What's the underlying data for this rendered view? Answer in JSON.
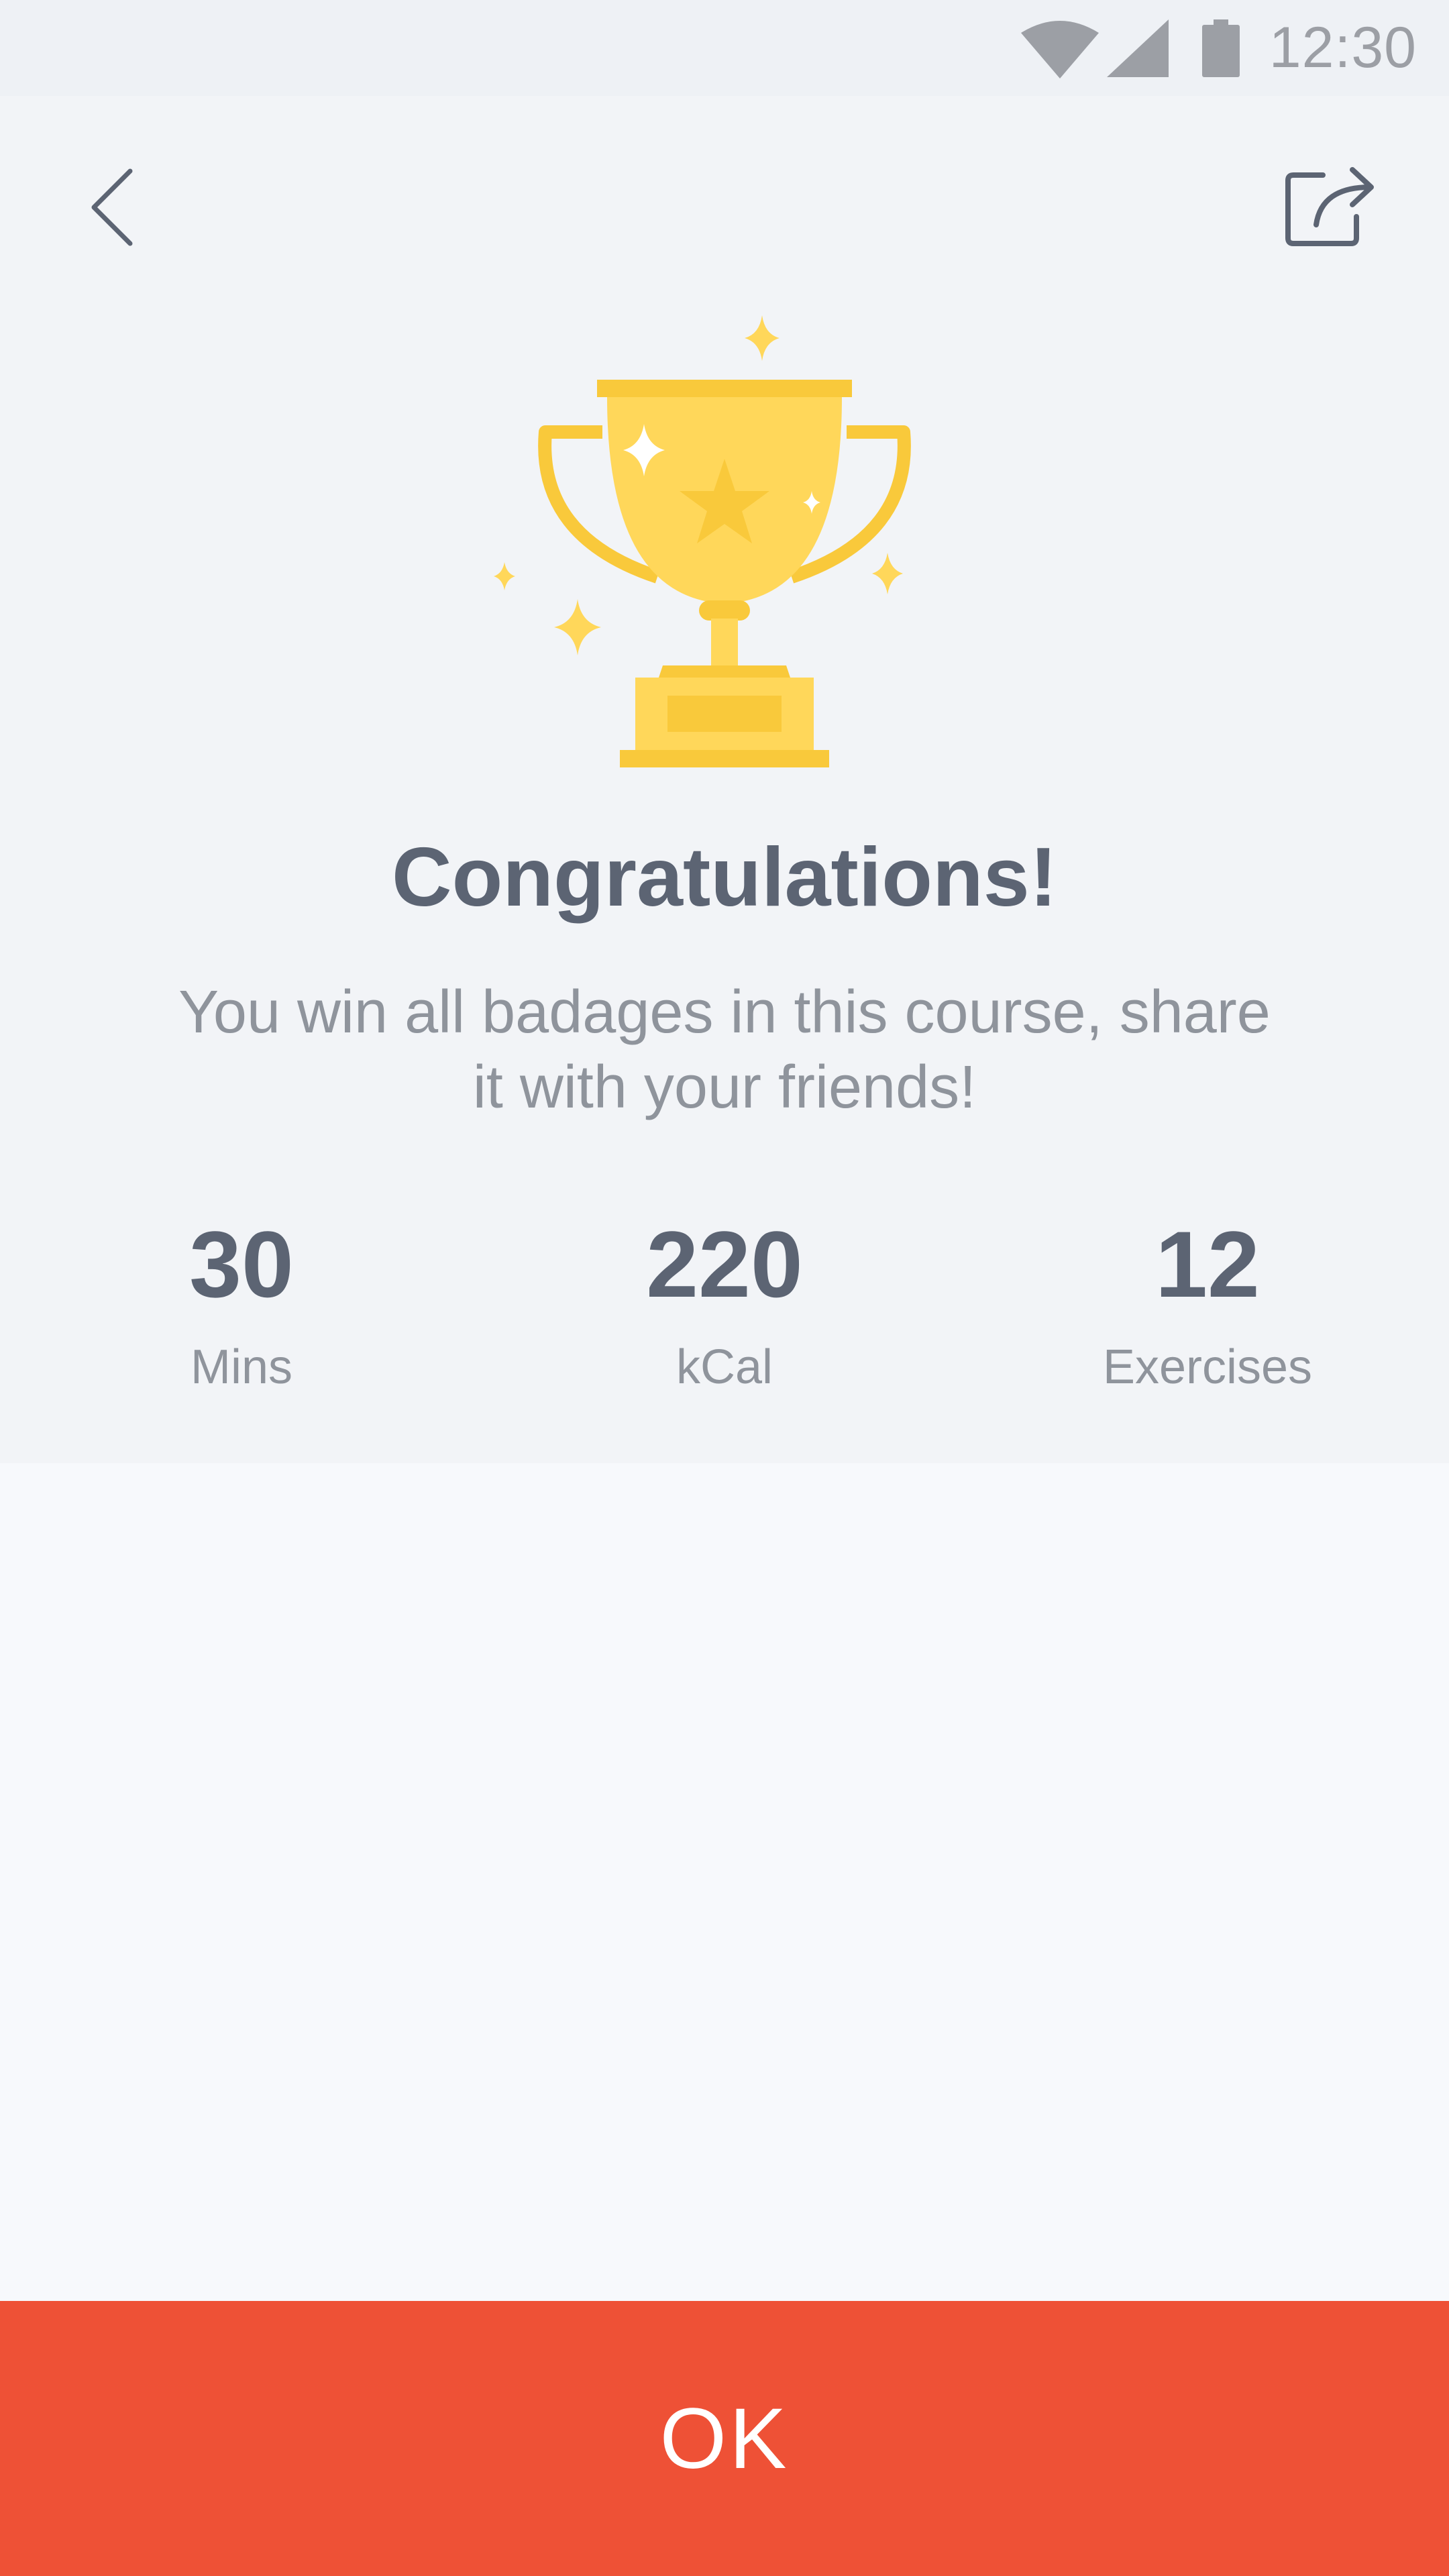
{
  "status_bar": {
    "time": "12:30",
    "icons": [
      "wifi-icon",
      "cellular-signal-icon",
      "battery-icon"
    ]
  },
  "header": {
    "back_icon": "chevron-left-icon",
    "share_icon": "share-icon"
  },
  "hero": {
    "illustration": "trophy-icon",
    "title": "Congratulations!",
    "subtitle_line1": "You win all badages in this course, share",
    "subtitle_line2": "it with your friends!"
  },
  "stats": [
    {
      "value": "30",
      "label": "Mins"
    },
    {
      "value": "220",
      "label": "kCal"
    },
    {
      "value": "12",
      "label": "Exercises"
    }
  ],
  "footer": {
    "ok_label": "OK"
  },
  "colors": {
    "accent": "#EE5136",
    "trophy_gold": "#FFD75A",
    "trophy_gold_dark": "#F9C93B",
    "text_dark": "#5C6473",
    "text_muted": "#8F949C",
    "hero_background": "#F2F4F7",
    "page_background": "#F7F9FC"
  }
}
